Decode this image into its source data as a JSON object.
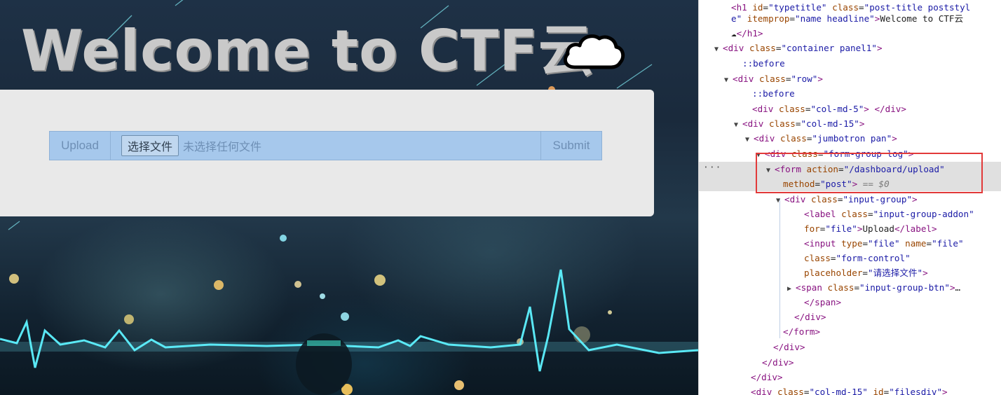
{
  "page": {
    "title_text": "Welcome to CTF云",
    "form": {
      "upload_label": "Upload",
      "choose_file_button": "选择文件",
      "no_file_text": "未选择任何文件",
      "submit_label": "Submit"
    }
  },
  "devtools": {
    "selected_suffix": "== $0",
    "lines": [
      {
        "tri": "",
        "html": "<span class='tag'>&lt;h1</span> <span class='attr'>id</span>=<span class='val'>\"typetitle\"</span> <span class='attr'>class</span>=<span class='val'>\"post-title poststyl</span>"
      },
      {
        "tri": "",
        "html": "<span class='val'>e\"</span> <span class='attr'>itemprop</span>=<span class='val'>\"name headline\"</span><span class='tag'>&gt;</span><span class='txt'>Welcome to CTF云</span>"
      },
      {
        "tri": "",
        "html": "<span class='txt'>☁</span><span class='tag'>&lt;/h1&gt;</span>"
      },
      {
        "tri": "▼",
        "html": "<span class='tag'>&lt;div</span> <span class='attr'>class</span>=<span class='val'>\"container panel1\"</span><span class='tag'>&gt;</span>"
      },
      {
        "tri": "",
        "html": "<span class='pseudo'>::before</span>"
      },
      {
        "tri": "▼",
        "html": "<span class='tag'>&lt;div</span> <span class='attr'>class</span>=<span class='val'>\"row\"</span><span class='tag'>&gt;</span>"
      },
      {
        "tri": "",
        "html": "<span class='pseudo'>::before</span>"
      },
      {
        "tri": "",
        "html": "<span class='tag'>&lt;div</span> <span class='attr'>class</span>=<span class='val'>\"col-md-5\"</span><span class='tag'>&gt;</span> <span class='tag'>&lt;/div&gt;</span>"
      },
      {
        "tri": "▼",
        "html": "<span class='tag'>&lt;div</span> <span class='attr'>class</span>=<span class='val'>\"col-md-15\"</span><span class='tag'>&gt;</span>"
      },
      {
        "tri": "▼",
        "html": "<span class='tag'>&lt;div</span> <span class='attr'>class</span>=<span class='val'>\"jumbotron pan\"</span><span class='tag'>&gt;</span>"
      },
      {
        "tri": "▼",
        "html": "<span class='tag'>&lt;div</span> <span class='attr'>class</span>=<span class='val'>\"form-group log\"</span><span class='tag'>&gt;</span>"
      },
      {
        "tri": "▼",
        "html": "<span class='tag'>&lt;form</span> <span class='attr'>action</span>=<span class='val'>\"/dashboard/upload\"</span>"
      },
      {
        "tri": "",
        "html": "<span class='attr'>method</span>=<span class='val'>\"post\"</span><span class='tag'>&gt;</span> <span class='eq'>== $0</span>"
      },
      {
        "tri": "▼",
        "html": "<span class='tag'>&lt;div</span> <span class='attr'>class</span>=<span class='val'>\"input-group\"</span><span class='tag'>&gt;</span>"
      },
      {
        "tri": "",
        "html": "<span class='tag'>&lt;label</span> <span class='attr'>class</span>=<span class='val'>\"input-group-addon\"</span>"
      },
      {
        "tri": "",
        "html": "<span class='attr'>for</span>=<span class='val'>\"file\"</span><span class='tag'>&gt;</span><span class='txt'>Upload</span><span class='tag'>&lt;/label&gt;</span>"
      },
      {
        "tri": "",
        "html": "<span class='tag'>&lt;input</span> <span class='attr'>type</span>=<span class='val'>\"file\"</span> <span class='attr'>name</span>=<span class='val'>\"file\"</span>"
      },
      {
        "tri": "",
        "html": "<span class='attr'>class</span>=<span class='val'>\"form-control\"</span>"
      },
      {
        "tri": "",
        "html": "<span class='attr'>placeholder</span>=<span class='val'>\"请选择文件\"</span><span class='tag'>&gt;</span>"
      },
      {
        "tri": "▶",
        "html": "<span class='tag'>&lt;span</span> <span class='attr'>class</span>=<span class='val'>\"input-group-btn\"</span><span class='tag'>&gt;</span>…"
      },
      {
        "tri": "",
        "html": "<span class='tag'>&lt;/span&gt;</span>"
      },
      {
        "tri": "",
        "html": "<span class='tag'>&lt;/div&gt;</span>"
      },
      {
        "tri": "",
        "html": "<span class='tag'>&lt;/form&gt;</span>"
      },
      {
        "tri": "",
        "html": "<span class='tag'>&lt;/div&gt;</span>"
      },
      {
        "tri": "",
        "html": "<span class='tag'>&lt;/div&gt;</span>"
      },
      {
        "tri": "",
        "html": "<span class='tag'>&lt;/div&gt;</span>"
      },
      {
        "tri": "",
        "html": "<span class='tag'>&lt;div</span> <span class='attr'>class</span>=<span class='val'>\"col-md-15\"</span> <span class='attr'>id</span>=<span class='val'>\"filesdiv\"</span><span class='tag'>&gt;</span>"
      }
    ]
  },
  "colors": {
    "title": "#c9c9c9",
    "jumbotron": "#e9e9e9",
    "input_group": "#a6c8ec",
    "highlight": "#e23a3a"
  }
}
